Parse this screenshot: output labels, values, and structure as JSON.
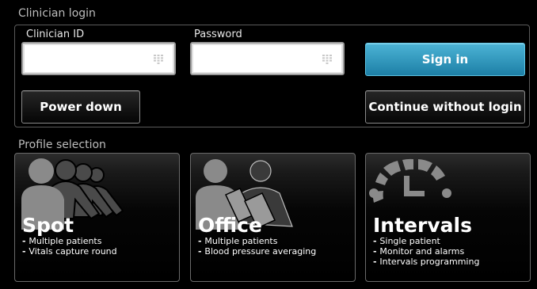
{
  "login": {
    "section_label": "Clinician login",
    "clinician_id_label": "Clinician ID",
    "clinician_id_value": "",
    "password_label": "Password",
    "password_value": "",
    "sign_in_label": "Sign in",
    "power_down_label": "Power down",
    "continue_label": "Continue without login"
  },
  "profiles": {
    "section_label": "Profile selection",
    "cards": [
      {
        "title": "Spot",
        "lines": [
          "Multiple patients",
          "Vitals capture round"
        ],
        "icon": "multiple-people-icon"
      },
      {
        "title": "Office",
        "lines": [
          "Multiple patients",
          "Blood pressure averaging"
        ],
        "icon": "people-bp-cuff-icon"
      },
      {
        "title": "Intervals",
        "lines": [
          "Single patient",
          "Monitor and alarms",
          "Intervals programming"
        ],
        "icon": "clock-icon"
      }
    ]
  },
  "colors": {
    "accent": "#2a9ac2",
    "background": "#000000"
  }
}
